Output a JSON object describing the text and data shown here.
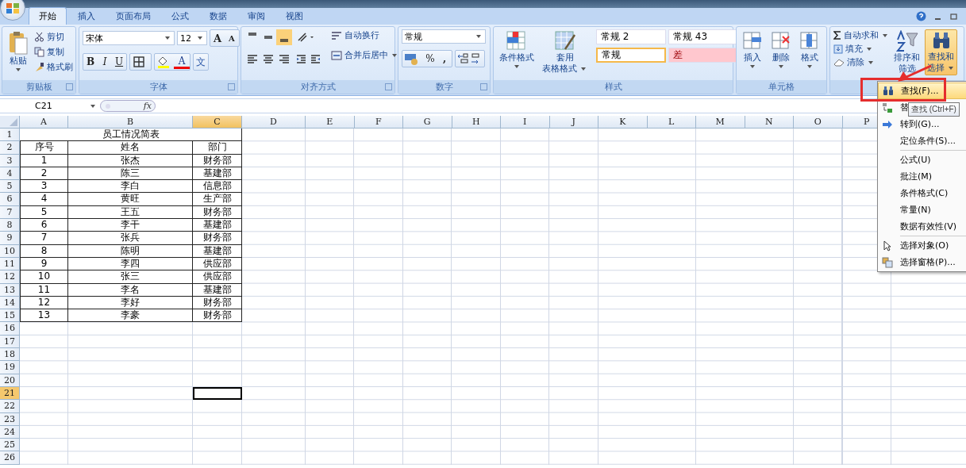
{
  "tabs": [
    {
      "label": "开始",
      "selected": true
    },
    {
      "label": "插入",
      "selected": false
    },
    {
      "label": "页面布局",
      "selected": false
    },
    {
      "label": "公式",
      "selected": false
    },
    {
      "label": "数据",
      "selected": false
    },
    {
      "label": "审阅",
      "selected": false
    },
    {
      "label": "视图",
      "selected": false
    }
  ],
  "ribbon": {
    "clipboard": {
      "label": "剪贴板",
      "paste": "粘贴",
      "actions": [
        "剪切",
        "复制",
        "格式刷"
      ]
    },
    "font": {
      "label": "字体",
      "family": "宋体",
      "size": "12",
      "grow": "A",
      "shrink": "A",
      "bold": "B",
      "italic": "I",
      "underline": "U",
      "font_color": "A",
      "phonetic": "文"
    },
    "alignment": {
      "label": "对齐方式",
      "wrap": "自动换行",
      "merge": "合并后居中"
    },
    "number": {
      "label": "数字",
      "format": "常规",
      "percent": "%",
      "comma": ","
    },
    "styles": {
      "label": "样式",
      "conditional": "条件格式",
      "table_format": [
        "套用",
        "表格格式"
      ],
      "cell_styles": [
        {
          "label": "常规 2",
          "kind": "plain",
          "selected": false
        },
        {
          "label": "常规 43",
          "kind": "plain",
          "selected": false
        },
        {
          "label": "常规",
          "kind": "plain",
          "selected": true
        },
        {
          "label": "差",
          "kind": "bad",
          "selected": false
        }
      ]
    },
    "cells": {
      "label": "单元格",
      "buttons": [
        "插入",
        "删除",
        "格式"
      ]
    },
    "editing": {
      "autosum": "自动求和",
      "fill": "填充",
      "clear": "清除",
      "sort": [
        "排序和",
        "筛选"
      ],
      "find": {
        "lines": [
          "查找和",
          "选择"
        ],
        "expanded": true
      }
    }
  },
  "formula_bar": {
    "name_box": "C21",
    "fx": "fx"
  },
  "sheet": {
    "columns": [
      {
        "label": "A",
        "selected": false
      },
      {
        "label": "B",
        "selected": false
      },
      {
        "label": "C",
        "selected": true
      },
      {
        "label": "D",
        "selected": false
      },
      {
        "label": "E",
        "selected": false
      },
      {
        "label": "F",
        "selected": false
      },
      {
        "label": "G",
        "selected": false
      },
      {
        "label": "H",
        "selected": false
      },
      {
        "label": "I",
        "selected": false
      },
      {
        "label": "J",
        "selected": false
      },
      {
        "label": "K",
        "selected": false
      },
      {
        "label": "L",
        "selected": false
      },
      {
        "label": "M",
        "selected": false
      },
      {
        "label": "N",
        "selected": false
      },
      {
        "label": "O",
        "selected": false
      },
      {
        "label": "P",
        "selected": false
      }
    ],
    "rows": [
      {
        "label": "1",
        "selected": false
      },
      {
        "label": "2",
        "selected": false
      },
      {
        "label": "3",
        "selected": false
      },
      {
        "label": "4",
        "selected": false
      },
      {
        "label": "5",
        "selected": false
      },
      {
        "label": "6",
        "selected": false
      },
      {
        "label": "7",
        "selected": false
      },
      {
        "label": "8",
        "selected": false
      },
      {
        "label": "9",
        "selected": false
      },
      {
        "label": "10",
        "selected": false
      },
      {
        "label": "11",
        "selected": false
      },
      {
        "label": "12",
        "selected": false
      },
      {
        "label": "13",
        "selected": false
      },
      {
        "label": "14",
        "selected": false
      },
      {
        "label": "15",
        "selected": false
      },
      {
        "label": "16",
        "selected": false
      },
      {
        "label": "17",
        "selected": false
      },
      {
        "label": "18",
        "selected": false
      },
      {
        "label": "19",
        "selected": false
      },
      {
        "label": "20",
        "selected": false
      },
      {
        "label": "21",
        "selected": true
      },
      {
        "label": "22",
        "selected": false
      },
      {
        "label": "23",
        "selected": false
      },
      {
        "label": "24",
        "selected": false
      },
      {
        "label": "25",
        "selected": false
      },
      {
        "label": "26",
        "selected": false
      }
    ],
    "title": "员工情况简表",
    "header": [
      "序号",
      "姓名",
      "部门"
    ],
    "records": [
      [
        "1",
        "张杰",
        "财务部"
      ],
      [
        "2",
        "陈三",
        "基建部"
      ],
      [
        "3",
        "李白",
        "信息部"
      ],
      [
        "4",
        "黄旺",
        "生产部"
      ],
      [
        "5",
        "王五",
        "财务部"
      ],
      [
        "6",
        "李干",
        "基建部"
      ],
      [
        "7",
        "张兵",
        "财务部"
      ],
      [
        "8",
        "陈明",
        "基建部"
      ],
      [
        "9",
        "李四",
        "供应部"
      ],
      [
        "10",
        "张三",
        "供应部"
      ],
      [
        "11",
        "李名",
        "基建部"
      ],
      [
        "12",
        "李好",
        "财务部"
      ],
      [
        "13",
        "李豪",
        "财务部"
      ]
    ]
  },
  "find_menu": {
    "sections": [
      [
        {
          "label": "查找(F)...",
          "kind": "binoculars",
          "selected": true
        },
        {
          "label": "替",
          "kind": "replace",
          "selected": false
        },
        {
          "label": "转到(G)...",
          "kind": "arrow",
          "selected": false
        },
        {
          "label": "定位条件(S)...",
          "kind": "none",
          "selected": false
        }
      ],
      [
        {
          "label": "公式(U)",
          "kind": "none",
          "selected": false
        },
        {
          "label": "批注(M)",
          "kind": "none",
          "selected": false
        },
        {
          "label": "条件格式(C)",
          "kind": "none",
          "selected": false
        },
        {
          "label": "常量(N)",
          "kind": "none",
          "selected": false
        },
        {
          "label": "数据有效性(V)",
          "kind": "none",
          "selected": false
        }
      ],
      [
        {
          "label": "选择对象(O)",
          "kind": "pointer",
          "selected": false
        },
        {
          "label": "选择窗格(P)...",
          "kind": "panes",
          "selected": false
        }
      ]
    ],
    "tooltip": "查找 (Ctrl+F)"
  }
}
